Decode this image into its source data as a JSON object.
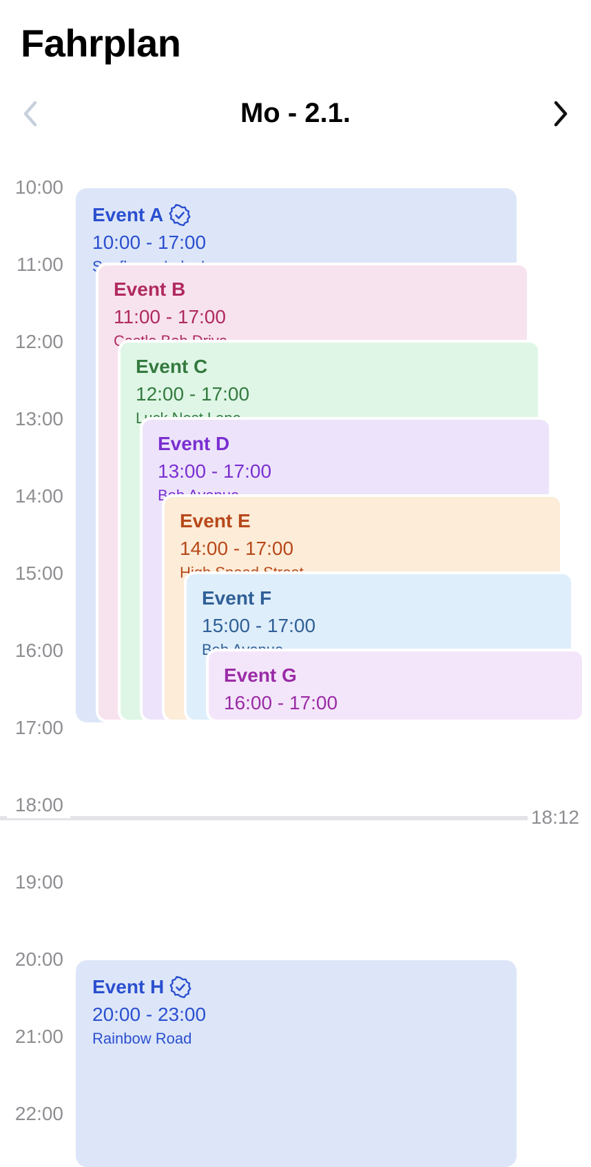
{
  "header": {
    "title": "Fahrplan"
  },
  "date_nav": {
    "date_label": "Mo - 2.1.",
    "prev_icon": "chevron-left-icon",
    "next_icon": "chevron-right-icon"
  },
  "timeline": {
    "hours": [
      "10:00",
      "11:00",
      "12:00",
      "13:00",
      "14:00",
      "15:00",
      "16:00",
      "17:00",
      "18:00",
      "19:00",
      "20:00",
      "21:00",
      "22:00"
    ],
    "now_time": "18:12"
  },
  "events": [
    {
      "id": "a",
      "title": "Event A",
      "time": "10:00 - 17:00",
      "location": "Sunflower Lake Lane",
      "verified": true,
      "bg": "#dde6f8",
      "fg": "#2a4fcf"
    },
    {
      "id": "b",
      "title": "Event B",
      "time": "11:00 - 17:00",
      "location": "Castle Bob Drive",
      "verified": false,
      "bg": "#f7e3ee",
      "fg": "#b02a60"
    },
    {
      "id": "c",
      "title": "Event C",
      "time": "12:00 - 17:00",
      "location": "Luck Nest Lane",
      "verified": false,
      "bg": "#dff6e6",
      "fg": "#337a3e"
    },
    {
      "id": "d",
      "title": "Event D",
      "time": "13:00 - 17:00",
      "location": "Bob Avenue",
      "verified": false,
      "bg": "#ede4fb",
      "fg": "#7a2fd0"
    },
    {
      "id": "e",
      "title": "Event E",
      "time": "14:00 - 17:00",
      "location": "High Speed Street",
      "verified": false,
      "bg": "#fcecd8",
      "fg": "#b8481a"
    },
    {
      "id": "f",
      "title": "Event F",
      "time": "15:00 - 17:00",
      "location": "Bob Avenue",
      "verified": false,
      "bg": "#dfeefb",
      "fg": "#2f5f96"
    },
    {
      "id": "g",
      "title": "Event G",
      "time": "16:00 - 17:00",
      "location": "",
      "verified": false,
      "bg": "#f4e6fa",
      "fg": "#9a2ca6"
    },
    {
      "id": "h",
      "title": "Event H",
      "time": "20:00 - 23:00",
      "location": "Rainbow Road",
      "verified": true,
      "bg": "#dde6f8",
      "fg": "#2a4fcf"
    }
  ]
}
